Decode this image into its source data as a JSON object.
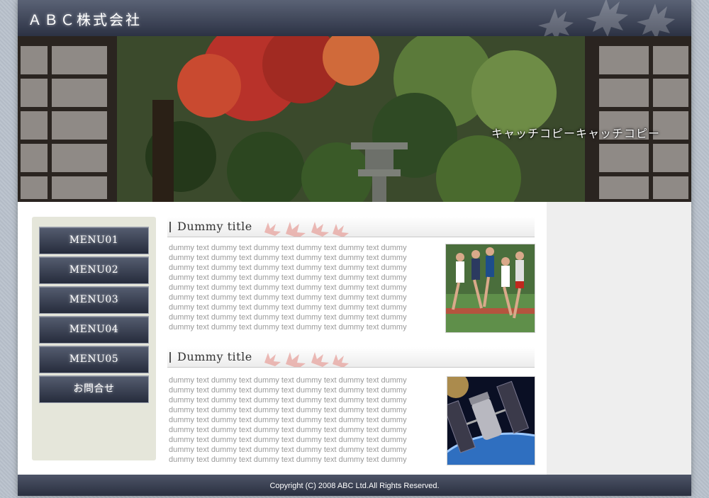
{
  "header": {
    "site_title": "ＡＢＣ株式会社"
  },
  "hero": {
    "catch_copy": "キャッチコピーキャッチコピー"
  },
  "sidebar": {
    "menu": [
      {
        "label": "MENU01"
      },
      {
        "label": "MENU02"
      },
      {
        "label": "MENU03"
      },
      {
        "label": "MENU04"
      },
      {
        "label": "MENU05"
      },
      {
        "label": "お問合せ"
      }
    ]
  },
  "sections": [
    {
      "title": "Dummy title",
      "body": "dummy text dummy text dummy text dummy text dummy text dummy dummy text dummy text dummy text dummy text dummy text dummy dummy text dummy text dummy text dummy text dummy text dummy dummy text dummy text dummy text dummy text dummy text dummy dummy text dummy text dummy text dummy text dummy text dummy dummy text dummy text dummy text dummy text dummy text dummy dummy text dummy text dummy text dummy text dummy text dummy dummy text dummy text dummy text dummy text dummy text dummy dummy text dummy text dummy text dummy text dummy text dummy",
      "image": "runners-photo"
    },
    {
      "title": "Dummy title",
      "body": "dummy text dummy text dummy text dummy text dummy text dummy dummy text dummy text dummy text dummy text dummy text dummy dummy text dummy text dummy text dummy text dummy text dummy dummy text dummy text dummy text dummy text dummy text dummy dummy text dummy text dummy text dummy text dummy text dummy dummy text dummy text dummy text dummy text dummy text dummy dummy text dummy text dummy text dummy text dummy text dummy dummy text dummy text dummy text dummy text dummy text dummy dummy text dummy text dummy text dummy text dummy text dummy",
      "image": "satellite-photo"
    }
  ],
  "footer": {
    "copyright": "Copyright (C) 2008 ABC Ltd.All Rights Reserved."
  },
  "colors": {
    "header_dark": "#2c3244",
    "sidebar_bg": "#e5e6da",
    "right_column_bg": "#eeeeee",
    "dummy_text": "#9a9a9a"
  }
}
